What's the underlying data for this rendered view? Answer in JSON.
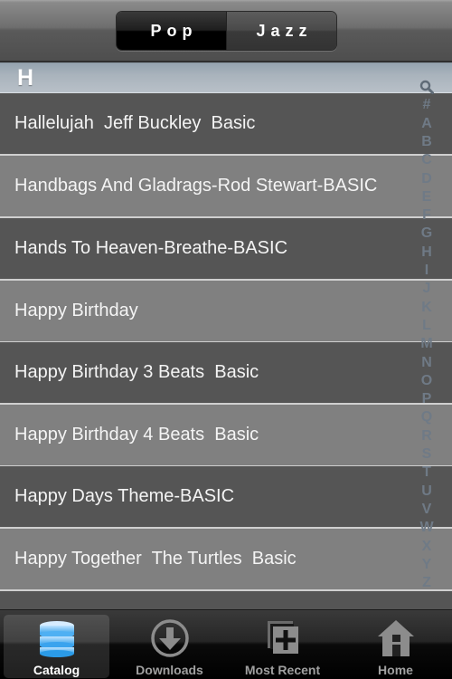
{
  "navbar": {
    "segments": [
      {
        "label": "Pop",
        "selected": true
      },
      {
        "label": "Jazz",
        "selected": false
      }
    ]
  },
  "section": {
    "title": "H"
  },
  "songs": [
    {
      "title": "Hallelujah  Jeff Buckley  Basic"
    },
    {
      "title": "Handbags And Gladrags-Rod Stewart-BASIC"
    },
    {
      "title": "Hands To Heaven-Breathe-BASIC"
    },
    {
      "title": "Happy Birthday"
    },
    {
      "title": "Happy Birthday 3 Beats  Basic"
    },
    {
      "title": "Happy Birthday 4 Beats  Basic"
    },
    {
      "title": "Happy Days Theme-BASIC"
    },
    {
      "title": "Happy Together  The Turtles  Basic"
    }
  ],
  "index": {
    "search_icon": "magnifier-icon",
    "letters": [
      "#",
      "A",
      "B",
      "C",
      "D",
      "E",
      "F",
      "G",
      "H",
      "I",
      "J",
      "K",
      "L",
      "M",
      "N",
      "O",
      "P",
      "Q",
      "R",
      "S",
      "T",
      "U",
      "V",
      "W",
      "X",
      "Y",
      "Z"
    ]
  },
  "tabbar": {
    "tabs": [
      {
        "label": "Catalog",
        "icon": "database-icon",
        "active": true
      },
      {
        "label": "Downloads",
        "icon": "download-icon",
        "active": false
      },
      {
        "label": "Most Recent",
        "icon": "add-stack-icon",
        "active": false
      },
      {
        "label": "Home",
        "icon": "home-icon",
        "active": false
      }
    ]
  },
  "colors": {
    "row_dark": "#555555",
    "row_light": "#808080",
    "separator": "#cfcfcf",
    "index_letter": "#6f7a86",
    "catalog_icon_blue": "#3fa9f5"
  }
}
